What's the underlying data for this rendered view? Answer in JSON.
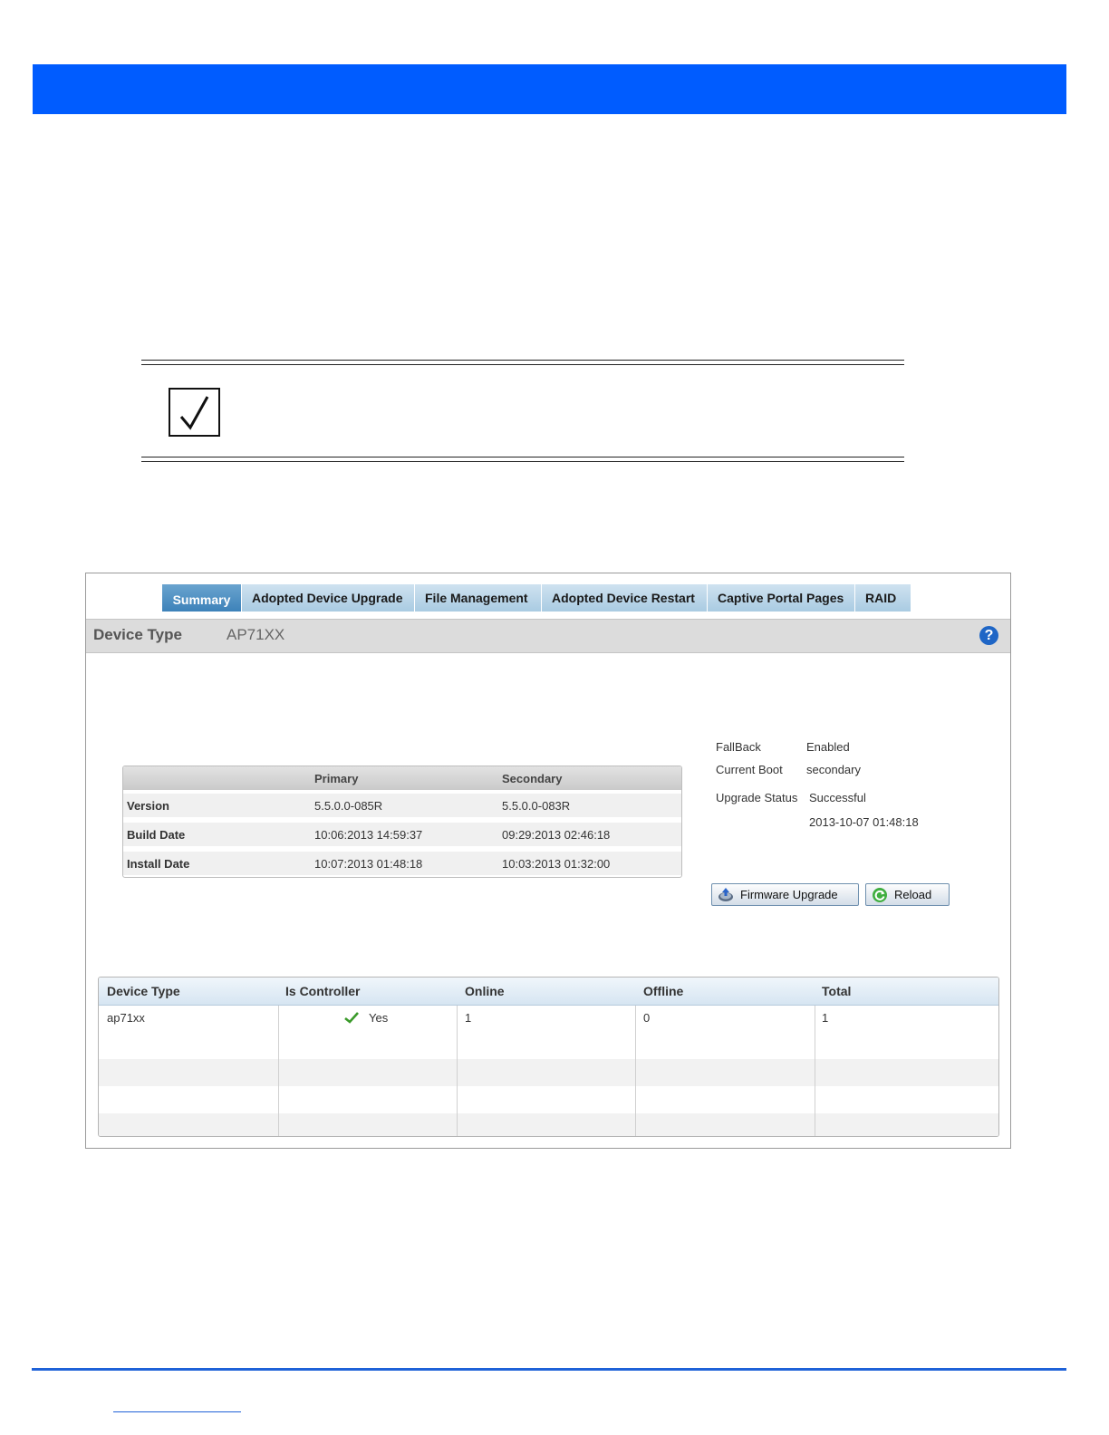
{
  "tabs": [
    {
      "label": "Summary",
      "active": true
    },
    {
      "label": "Adopted Device Upgrade",
      "active": false
    },
    {
      "label": "File Management",
      "active": false
    },
    {
      "label": "Adopted Device Restart",
      "active": false
    },
    {
      "label": "Captive Portal Pages",
      "active": false
    },
    {
      "label": "RAID",
      "active": false
    }
  ],
  "header": {
    "label": "Device Type",
    "value": "AP71XX",
    "help_icon": "question-circle-icon"
  },
  "version_table": {
    "columns": [
      "",
      "Primary",
      "Secondary"
    ],
    "rows": [
      {
        "label": "Version",
        "primary": "5.5.0.0-085R",
        "secondary": "5.5.0.0-083R"
      },
      {
        "label": "Build Date",
        "primary": "10:06:2013 14:59:37",
        "secondary": "09:29:2013 02:46:18"
      },
      {
        "label": "Install Date",
        "primary": "10:07:2013 01:48:18",
        "secondary": "10:03:2013 01:32:00"
      }
    ]
  },
  "status": {
    "fallback_label": "FallBack",
    "fallback_value": "Enabled",
    "current_boot_label": "Current Boot",
    "current_boot_value": "secondary",
    "upgrade_status_label": "Upgrade Status",
    "upgrade_status_value": "Successful",
    "upgrade_time": "2013-10-07 01:48:18"
  },
  "buttons": {
    "firmware_upgrade": "Firmware Upgrade",
    "reload": "Reload"
  },
  "device_table": {
    "columns": [
      "Device Type",
      "Is Controller",
      "Online",
      "Offline",
      "Total"
    ],
    "rows": [
      {
        "device_type": "ap71xx",
        "is_controller": "Yes",
        "online": "1",
        "offline": "0",
        "total": "1"
      }
    ]
  },
  "colors": {
    "banner": "#005cff",
    "active_tab": "#3d82b9",
    "footer_rule": "#1f62d8"
  }
}
